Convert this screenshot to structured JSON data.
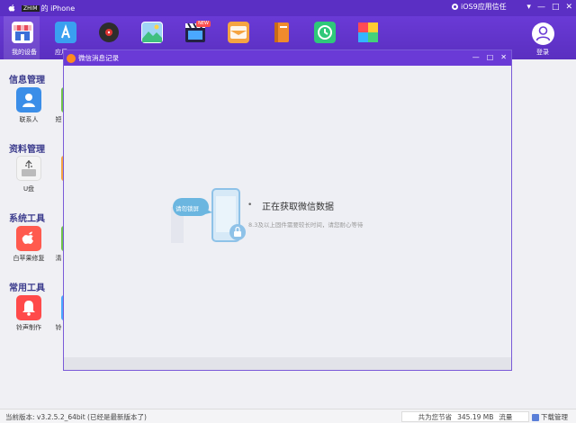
{
  "titlebar": {
    "device_tag": "ZHIM",
    "device_name": "的 iPhone",
    "trust_label": "iOS9应用信任",
    "controls": [
      "▾",
      "—",
      "□",
      "✕"
    ]
  },
  "toolbar": {
    "items": [
      {
        "label": "我的设备",
        "icon": "store-icon",
        "color": "#e84c5c"
      },
      {
        "label": "应用",
        "icon": "app-store-icon",
        "color": "#3aa0f0"
      },
      {
        "label": "",
        "icon": "music-disc-icon",
        "color": "#2d2d2d"
      },
      {
        "label": "",
        "icon": "photos-icon",
        "color": "#3fbf7f"
      },
      {
        "label": "",
        "icon": "video-clapper-icon",
        "color": "#222244"
      },
      {
        "label": "",
        "icon": "wallet-icon",
        "color": "#f5a442"
      },
      {
        "label": "",
        "icon": "books-icon",
        "color": "#f08b2d"
      },
      {
        "label": "",
        "icon": "sync-icon",
        "color": "#2fc87a"
      },
      {
        "label": "",
        "icon": "tiles-icon",
        "color": "#ff6e3a"
      }
    ],
    "new_badge": "NEW",
    "login_label": "登录"
  },
  "sidebar": {
    "sections": [
      {
        "title": "信息管理",
        "item_label": "联系人",
        "peek_label": "短",
        "icon": "contacts-icon",
        "color": "#3b8ee8"
      },
      {
        "title": "资料管理",
        "item_label": "U盘",
        "peek_label": "",
        "icon": "usb-drive-icon",
        "color": "#f4f4f4"
      },
      {
        "title": "系统工具",
        "item_label": "白苹果修复",
        "peek_label": "清",
        "icon": "apple-repair-icon",
        "color": "#ff5a4e"
      },
      {
        "title": "常用工具",
        "item_label": "铃声制作",
        "peek_label": "铃",
        "icon": "bell-icon",
        "color": "#ff4a4a"
      }
    ]
  },
  "dialog": {
    "title": "微信消息记录",
    "bubble_text": "请勿锁屏",
    "loading_title": "正在获取微信数据",
    "loading_sub": "8.3及以上固件需要较长时间，请您耐心等待",
    "controls": [
      "—",
      "□",
      "✕"
    ]
  },
  "statusbar": {
    "version": "当前版本: v3.2.5.2_64bit  (已经是最新版本了)",
    "saved_prefix": "共为您节省",
    "saved_value": "345.19 MB",
    "saved_suffix": "流量",
    "download": "下载管理"
  },
  "colors": {
    "brand": "#5b2fc4",
    "dialog_border": "#7a5ad8",
    "phone_blue": "#8ec2e8"
  }
}
